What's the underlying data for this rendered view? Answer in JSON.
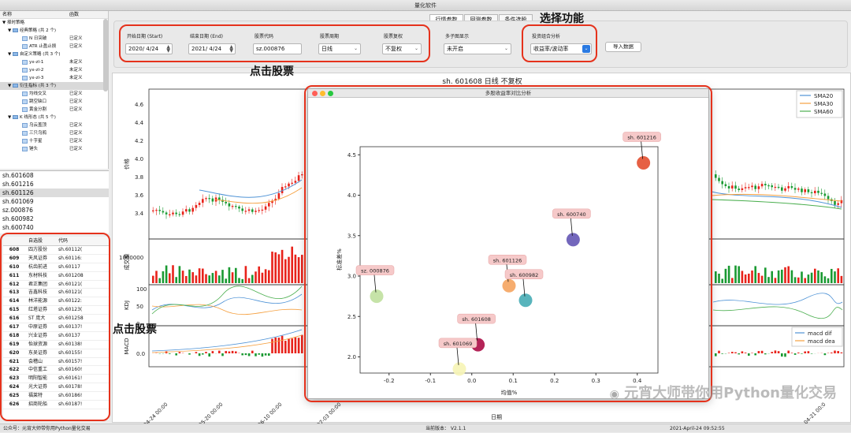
{
  "window": {
    "title": "量化软件"
  },
  "tree": {
    "col_name": "名称",
    "col_func": "函数",
    "root": "择时策略",
    "rows": [
      {
        "label": "经典策略 (共 2 个)",
        "level": 1,
        "type": ""
      },
      {
        "label": "N 日突破",
        "level": 2,
        "type": "已定义"
      },
      {
        "label": "ATR 止盈止损",
        "level": 2,
        "type": "已定义"
      },
      {
        "label": "自定义策略 (共 3 个)",
        "level": 1,
        "type": ""
      },
      {
        "label": "yx-zl-1",
        "level": 2,
        "type": "未定义"
      },
      {
        "label": "yx-zl-2",
        "level": 2,
        "type": "未定义"
      },
      {
        "label": "yx-zl-3",
        "level": 2,
        "type": "未定义"
      },
      {
        "label": "衍生指标 (共 3 个)",
        "level": 1,
        "type": ""
      },
      {
        "label": "均线交叉",
        "level": 2,
        "type": "已定义"
      },
      {
        "label": "跳空缺口",
        "level": 2,
        "type": "已定义"
      },
      {
        "label": "黄金分割",
        "level": 2,
        "type": "已定义"
      },
      {
        "label": "K 线形态 (共 5 个)",
        "level": 1,
        "type": ""
      },
      {
        "label": "乌云盖顶",
        "level": 2,
        "type": "已定义"
      },
      {
        "label": "三只乌鸦",
        "level": 2,
        "type": "已定义"
      },
      {
        "label": "十字星",
        "level": 2,
        "type": "已定义"
      },
      {
        "label": "锤头",
        "level": 2,
        "type": "已定义"
      }
    ]
  },
  "code_list": [
    "sh.601608",
    "sh.601216",
    "sh.601126",
    "sh.601069",
    "sz.000876",
    "sh.600982",
    "sh.600740"
  ],
  "code_list_selected": 2,
  "stock_table": {
    "headers": [
      "",
      "自选股",
      "代码"
    ],
    "rows": [
      [
        "608",
        "四方股份",
        "sh.60112("
      ],
      [
        "609",
        "天风证券",
        "sh.60116:"
      ],
      [
        "610",
        "杭齿前进",
        "sh.60117"
      ],
      [
        "611",
        "东材科技",
        "sh.601208"
      ],
      [
        "612",
        "君正集团",
        "sh.60121("
      ],
      [
        "613",
        "吉鑫科技",
        "sh.60121("
      ],
      [
        "614",
        "林洋能源",
        "sh.60122:"
      ],
      [
        "615",
        "红塔证券",
        "sh.60123("
      ],
      [
        "616",
        "ST 庞大",
        "sh.601258"
      ],
      [
        "617",
        "中原证券",
        "sh.60137!"
      ],
      [
        "618",
        "兴业证券",
        "sh.60137"
      ],
      [
        "619",
        "怡球资源",
        "sh.60138!"
      ],
      [
        "620",
        "东吴证券",
        "sh.60155!"
      ],
      [
        "621",
        "会稽山",
        "sh.60157!"
      ],
      [
        "622",
        "中信重工",
        "sh.60160!"
      ],
      [
        "623",
        "明阳智能",
        "sh.60161!"
      ],
      [
        "624",
        "光大证券",
        "sh.60178!"
      ],
      [
        "625",
        "福莱特",
        "sh.60186!"
      ],
      [
        "626",
        "招商轮船",
        "sh.60187!"
      ]
    ]
  },
  "tabs": [
    "行情参数",
    "回测参数",
    "条件选股"
  ],
  "params": {
    "start_label": "开始日期 (Start)",
    "start_value": "2020/ 4/24",
    "end_label": "结束日期 (End)",
    "end_value": "2021/ 4/24",
    "code_label": "股票代码",
    "code_value": "sz.000876",
    "period_label": "股票周期",
    "period_value": "日线",
    "adjust_label": "股票复权",
    "adjust_value": "不复权",
    "subplot_label": "多子图显示",
    "subplot_value": "未开启",
    "analysis_label": "投资组合分析",
    "analysis_value": "收益率/波动率",
    "import_button": "导入数据"
  },
  "annotations": {
    "select_function": "选择功能",
    "click_stock_1": "点击股票",
    "click_stock_2": "点击股票"
  },
  "main_chart": {
    "title": "sh. 601608 日线 不复权",
    "ylabel_price": "价格",
    "ylabel_volume": "成交量",
    "ylabel_kdj": "KDJ",
    "ylabel_macd": "MACD",
    "xlabel": "日期",
    "price_ticks": [
      "4.6",
      "4.4",
      "4.2",
      "4.0",
      "3.8",
      "3.6",
      "3.4"
    ],
    "volume_tick": "1000000",
    "kdj_ticks": [
      "100",
      "50",
      "0"
    ],
    "macd_ticks": [
      "0.0"
    ],
    "x_ticks": [
      "2020-04-24 00:00",
      "2020-05-20 00:00",
      "2020-06-10 00:00",
      "2020-07-03 00:00",
      "2021-04-21 00:0"
    ],
    "legend": [
      "SMA20",
      "SMA30",
      "SMA60"
    ],
    "macd_legend": [
      "macd dif",
      "macd dea"
    ],
    "colors": {
      "up": "#e8231b",
      "down": "#1a9a32",
      "sma20": "#4f93d6",
      "sma30": "#f5a040",
      "sma60": "#4caf50"
    }
  },
  "popup": {
    "title": "多股收益率对比分析",
    "xlabel": "均值%",
    "ylabel": "标准差%",
    "x_ticks": [
      "-0.2",
      "-0.1",
      "0.0",
      "0.1",
      "0.2",
      "0.3",
      "0.4"
    ],
    "y_ticks": [
      "2.0",
      "2.5",
      "3.0",
      "3.5",
      "4.0",
      "4.5"
    ]
  },
  "chart_data": {
    "type": "scatter",
    "title": "",
    "xlabel": "均值%",
    "ylabel": "标准差%",
    "xlim": [
      -0.27,
      0.45
    ],
    "ylim": [
      1.8,
      4.6
    ],
    "points": [
      {
        "label": "sh. 601216",
        "x": 0.415,
        "y": 4.4,
        "color": "#e5573a"
      },
      {
        "label": "sh. 600740",
        "x": 0.245,
        "y": 3.45,
        "color": "#6c5fb8"
      },
      {
        "label": "sh. 601126",
        "x": 0.09,
        "y": 2.88,
        "color": "#f5a967"
      },
      {
        "label": "sh. 600982",
        "x": 0.13,
        "y": 2.7,
        "color": "#4fb0b8"
      },
      {
        "label": "sz. 000876",
        "x": -0.23,
        "y": 2.75,
        "color": "#c3e2a3"
      },
      {
        "label": "sh. 601608",
        "x": 0.015,
        "y": 2.15,
        "color": "#b0184f"
      },
      {
        "label": "sh. 601069",
        "x": -0.03,
        "y": 1.85,
        "color": "#f7f4b8"
      }
    ]
  },
  "status": {
    "left": "公众号：元宵大师带你用Python量化交易",
    "version": "当前版本： V2.1.1",
    "datetime": "2021-April-24 09:52:55"
  },
  "watermark": "元宵大师带你用Python量化交易"
}
